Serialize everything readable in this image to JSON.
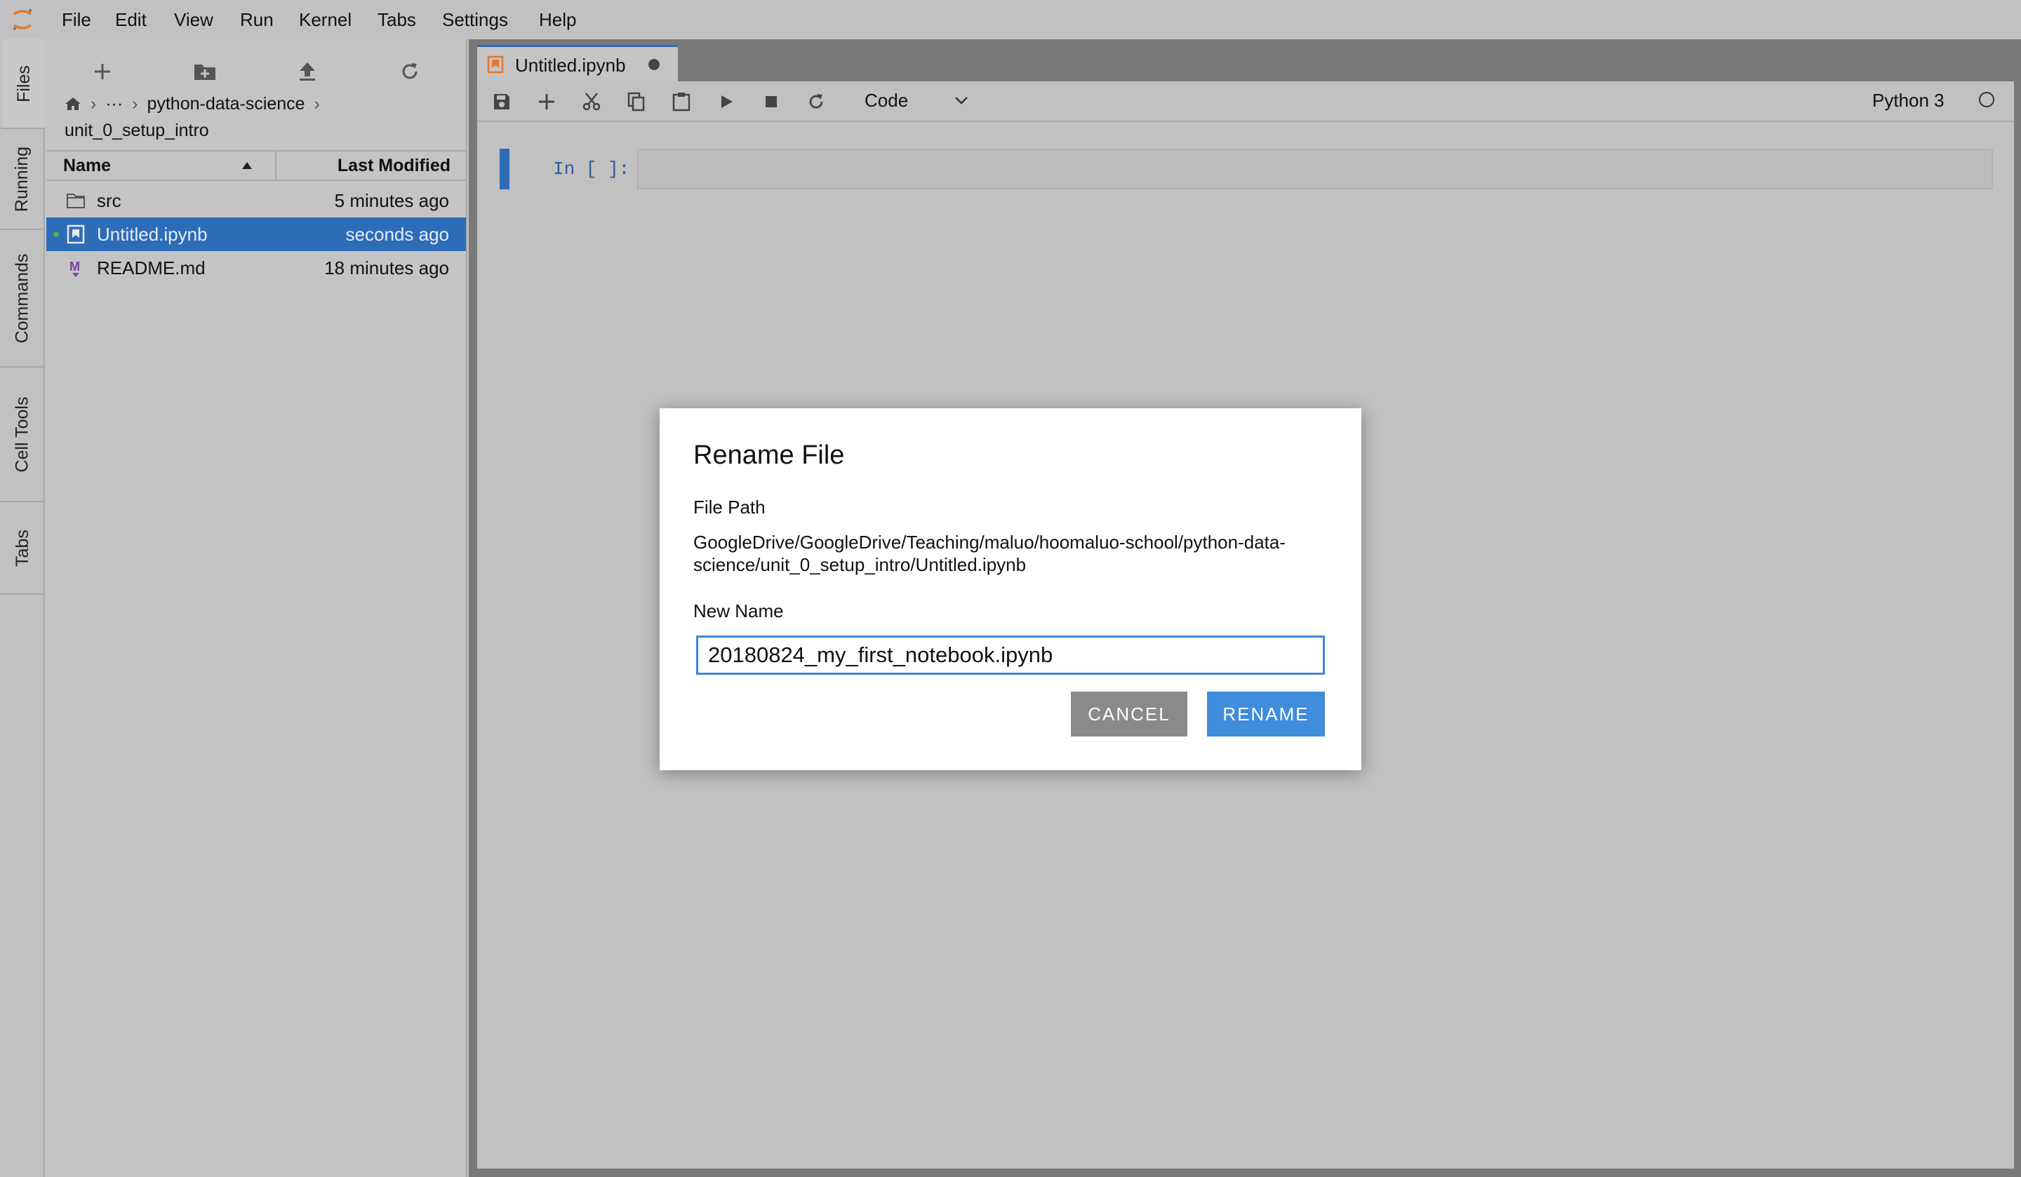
{
  "menubar": {
    "items": [
      "File",
      "Edit",
      "View",
      "Run",
      "Kernel",
      "Tabs",
      "Settings",
      "Help"
    ],
    "logo_icon": "jupyter-logo-icon"
  },
  "left_tabs": [
    "Files",
    "Running",
    "Commands",
    "Cell Tools",
    "Tabs"
  ],
  "file_browser": {
    "toolbar_icons": [
      "new-launcher-icon",
      "new-folder-icon",
      "upload-icon",
      "refresh-icon"
    ],
    "breadcrumb": {
      "home_icon": "home-icon",
      "ellipsis": "···",
      "folder": "python-data-science",
      "current": "unit_0_setup_intro"
    },
    "columns": {
      "name": "Name",
      "modified": "Last Modified"
    },
    "files": [
      {
        "name": "src",
        "modified": "5 minutes ago",
        "icon": "folder-icon"
      },
      {
        "name": "Untitled.ipynb",
        "modified": "seconds ago",
        "icon": "notebook-icon"
      },
      {
        "name": "README.md",
        "modified": "18 minutes ago",
        "icon": "markdown-icon"
      }
    ]
  },
  "notebook": {
    "tab_title": "Untitled.ipynb",
    "cell_type": "Code",
    "kernel": "Python 3",
    "prompt": "In [ ]:"
  },
  "dialog": {
    "title": "Rename File",
    "path_label": "File Path",
    "path_line1": "GoogleDrive/GoogleDrive/Teaching/maluo/hoomaluo-school/python-data-",
    "path_line2": "science/unit_0_setup_intro/Untitled.ipynb",
    "name_label": "New Name",
    "name_value": "20180824_my_first_notebook.ipynb",
    "cancel": "CANCEL",
    "rename": "RENAME"
  },
  "colors": {
    "accent": "#2d6db8",
    "rename_button": "#3f8ddb",
    "cancel_button": "#8a8a8a",
    "jupyter_orange": "#e4772b"
  }
}
